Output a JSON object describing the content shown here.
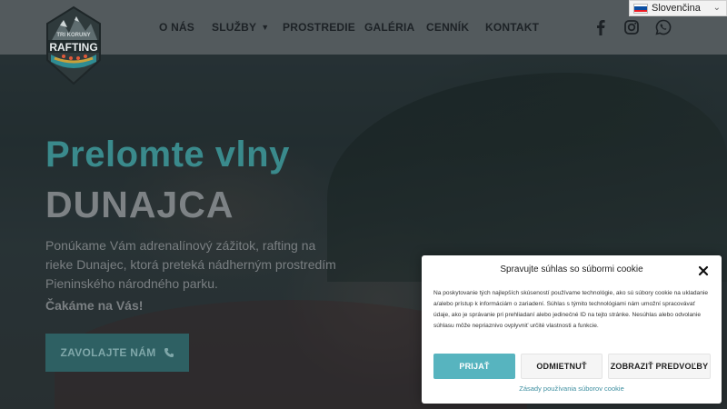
{
  "header": {
    "logo_text": "RAFTING",
    "logo_arc_text": "TRI KORUNY"
  },
  "nav": {
    "items": [
      {
        "label": "O NÁS"
      },
      {
        "label": "SLUŽBY"
      },
      {
        "label": "PROSTREDIE"
      },
      {
        "label": "GALÉRIA"
      },
      {
        "label": "CENNÍK"
      },
      {
        "label": "KONTAKT"
      }
    ],
    "social_icons": [
      "facebook-icon",
      "instagram-icon",
      "whatsapp-icon"
    ]
  },
  "language": {
    "selected": "Slovenčina",
    "flag": "slovak-flag-icon"
  },
  "hero": {
    "title_line1": "Prelomte vlny",
    "title_line2": "DUNAJCA",
    "body": "Ponúkame Vám adrenalínový zážitok, rafting na rieke Dunajec, ktorá preteká nádherným prostredím Pieninského národného parku.",
    "tagline": "Čakáme na Vás!",
    "cta_label": "ZAVOLAJTE NÁM",
    "cta_icon": "phone-icon"
  },
  "cookie": {
    "title": "Spravujte súhlas so súbormi cookie",
    "text": "Na poskytovanie tých najlepších skúseností používame technológie, ako sú súbory cookie na ukladanie a/alebo prístup k informáciám o zariadení. Súhlas s týmito technológiami nám umožní spracovávať údaje, ako je správanie pri prehliadaní alebo jedinečné ID na tejto stránke. Nesúhlas alebo odvolanie súhlasu môže nepriaznivo ovplyvniť určité vlastnosti a funkcie.",
    "accept_label": "PRIJAŤ",
    "deny_label": "ODMIETNUŤ",
    "prefs_label": "ZOBRAZIŤ PREDVOĽBY",
    "policy_link": "Zásady používania súborov cookie"
  },
  "colors": {
    "accent": "#57b4bf",
    "hero_title": "#3a8a8c",
    "cta_bg": "#2e6063",
    "header_bg": "#535a5d"
  }
}
